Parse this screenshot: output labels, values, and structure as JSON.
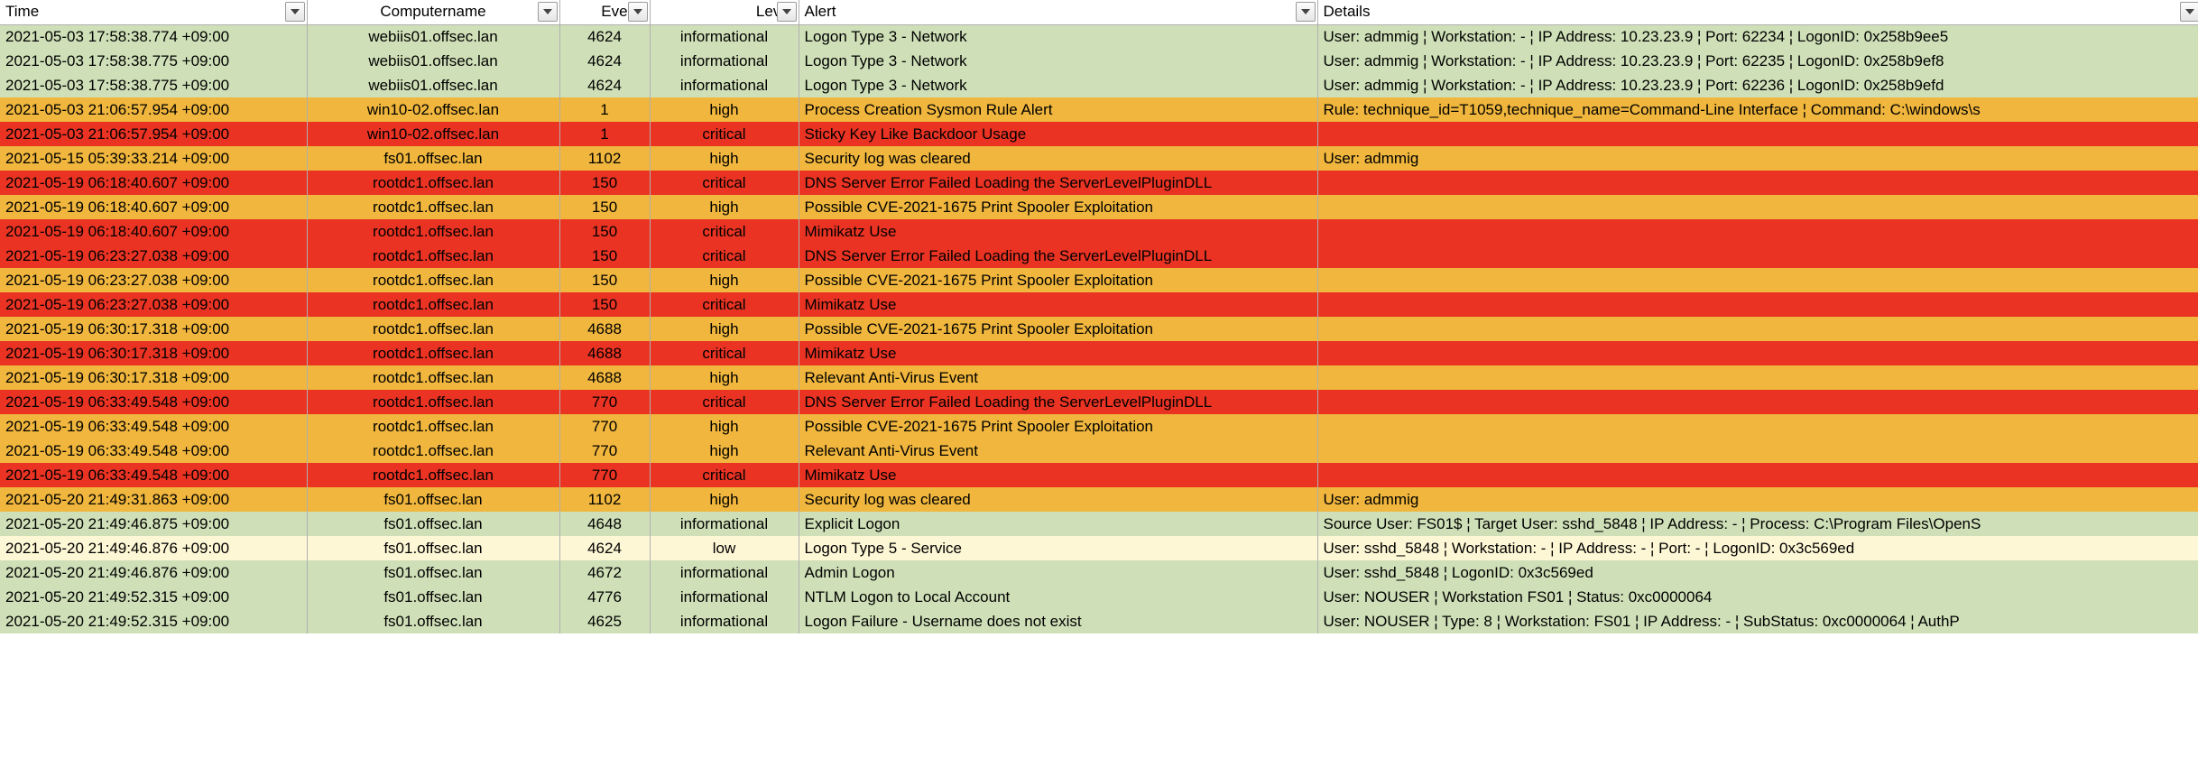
{
  "headers": {
    "time": "Time",
    "computer": "Computername",
    "eventid": "Eventi",
    "level": "Level",
    "alert": "Alert",
    "details": "Details"
  },
  "rows": [
    {
      "level": "informational",
      "time": "2021-05-03 17:58:38.774 +09:00",
      "computer": "webiis01.offsec.lan",
      "eventid": "4624",
      "levelText": "informational",
      "alert": "Logon Type 3 - Network",
      "details": "User: admmig  ¦  Workstation: -  ¦  IP Address: 10.23.23.9  ¦  Port: 62234  ¦  LogonID: 0x258b9ee5"
    },
    {
      "level": "informational",
      "time": "2021-05-03 17:58:38.775 +09:00",
      "computer": "webiis01.offsec.lan",
      "eventid": "4624",
      "levelText": "informational",
      "alert": "Logon Type 3 - Network",
      "details": "User: admmig  ¦  Workstation: -  ¦  IP Address: 10.23.23.9  ¦  Port: 62235  ¦  LogonID: 0x258b9ef8"
    },
    {
      "level": "informational",
      "time": "2021-05-03 17:58:38.775 +09:00",
      "computer": "webiis01.offsec.lan",
      "eventid": "4624",
      "levelText": "informational",
      "alert": "Logon Type 3 - Network",
      "details": "User: admmig  ¦  Workstation: -  ¦  IP Address: 10.23.23.9  ¦  Port: 62236  ¦  LogonID: 0x258b9efd"
    },
    {
      "level": "high",
      "time": "2021-05-03 21:06:57.954 +09:00",
      "computer": "win10-02.offsec.lan",
      "eventid": "1",
      "levelText": "high",
      "alert": "Process Creation Sysmon Rule Alert",
      "details": "Rule: technique_id=T1059,technique_name=Command-Line Interface  ¦  Command: C:\\windows\\s"
    },
    {
      "level": "critical",
      "time": "2021-05-03 21:06:57.954 +09:00",
      "computer": "win10-02.offsec.lan",
      "eventid": "1",
      "levelText": "critical",
      "alert": "Sticky Key Like Backdoor Usage",
      "details": ""
    },
    {
      "level": "high",
      "time": "2021-05-15 05:39:33.214 +09:00",
      "computer": "fs01.offsec.lan",
      "eventid": "1102",
      "levelText": "high",
      "alert": "Security log was cleared",
      "details": "User: admmig"
    },
    {
      "level": "critical",
      "time": "2021-05-19 06:18:40.607 +09:00",
      "computer": "rootdc1.offsec.lan",
      "eventid": "150",
      "levelText": "critical",
      "alert": "DNS Server Error Failed Loading the ServerLevelPluginDLL",
      "details": ""
    },
    {
      "level": "high",
      "time": "2021-05-19 06:18:40.607 +09:00",
      "computer": "rootdc1.offsec.lan",
      "eventid": "150",
      "levelText": "high",
      "alert": "Possible CVE-2021-1675 Print Spooler Exploitation",
      "details": ""
    },
    {
      "level": "critical",
      "time": "2021-05-19 06:18:40.607 +09:00",
      "computer": "rootdc1.offsec.lan",
      "eventid": "150",
      "levelText": "critical",
      "alert": "Mimikatz Use",
      "details": ""
    },
    {
      "level": "critical",
      "time": "2021-05-19 06:23:27.038 +09:00",
      "computer": "rootdc1.offsec.lan",
      "eventid": "150",
      "levelText": "critical",
      "alert": "DNS Server Error Failed Loading the ServerLevelPluginDLL",
      "details": ""
    },
    {
      "level": "high",
      "time": "2021-05-19 06:23:27.038 +09:00",
      "computer": "rootdc1.offsec.lan",
      "eventid": "150",
      "levelText": "high",
      "alert": "Possible CVE-2021-1675 Print Spooler Exploitation",
      "details": ""
    },
    {
      "level": "critical",
      "time": "2021-05-19 06:23:27.038 +09:00",
      "computer": "rootdc1.offsec.lan",
      "eventid": "150",
      "levelText": "critical",
      "alert": "Mimikatz Use",
      "details": ""
    },
    {
      "level": "high",
      "time": "2021-05-19 06:30:17.318 +09:00",
      "computer": "rootdc1.offsec.lan",
      "eventid": "4688",
      "levelText": "high",
      "alert": "Possible CVE-2021-1675 Print Spooler Exploitation",
      "details": ""
    },
    {
      "level": "critical",
      "time": "2021-05-19 06:30:17.318 +09:00",
      "computer": "rootdc1.offsec.lan",
      "eventid": "4688",
      "levelText": "critical",
      "alert": "Mimikatz Use",
      "details": ""
    },
    {
      "level": "high",
      "time": "2021-05-19 06:30:17.318 +09:00",
      "computer": "rootdc1.offsec.lan",
      "eventid": "4688",
      "levelText": "high",
      "alert": "Relevant Anti-Virus Event",
      "details": ""
    },
    {
      "level": "critical",
      "time": "2021-05-19 06:33:49.548 +09:00",
      "computer": "rootdc1.offsec.lan",
      "eventid": "770",
      "levelText": "critical",
      "alert": "DNS Server Error Failed Loading the ServerLevelPluginDLL",
      "details": ""
    },
    {
      "level": "high",
      "time": "2021-05-19 06:33:49.548 +09:00",
      "computer": "rootdc1.offsec.lan",
      "eventid": "770",
      "levelText": "high",
      "alert": "Possible CVE-2021-1675 Print Spooler Exploitation",
      "details": ""
    },
    {
      "level": "high",
      "time": "2021-05-19 06:33:49.548 +09:00",
      "computer": "rootdc1.offsec.lan",
      "eventid": "770",
      "levelText": "high",
      "alert": "Relevant Anti-Virus Event",
      "details": ""
    },
    {
      "level": "critical",
      "time": "2021-05-19 06:33:49.548 +09:00",
      "computer": "rootdc1.offsec.lan",
      "eventid": "770",
      "levelText": "critical",
      "alert": "Mimikatz Use",
      "details": ""
    },
    {
      "level": "high",
      "time": "2021-05-20 21:49:31.863 +09:00",
      "computer": "fs01.offsec.lan",
      "eventid": "1102",
      "levelText": "high",
      "alert": "Security log was cleared",
      "details": "User: admmig"
    },
    {
      "level": "informational",
      "time": "2021-05-20 21:49:46.875 +09:00",
      "computer": "fs01.offsec.lan",
      "eventid": "4648",
      "levelText": "informational",
      "alert": "Explicit Logon",
      "details": "Source User: FS01$  ¦  Target User: sshd_5848  ¦  IP Address: -  ¦  Process: C:\\Program Files\\OpenS"
    },
    {
      "level": "low",
      "time": "2021-05-20 21:49:46.876 +09:00",
      "computer": "fs01.offsec.lan",
      "eventid": "4624",
      "levelText": "low",
      "alert": "Logon Type 5 - Service",
      "details": "User: sshd_5848  ¦  Workstation: -  ¦  IP Address: -  ¦  Port: -  ¦  LogonID: 0x3c569ed"
    },
    {
      "level": "informational",
      "time": "2021-05-20 21:49:46.876 +09:00",
      "computer": "fs01.offsec.lan",
      "eventid": "4672",
      "levelText": "informational",
      "alert": "Admin Logon",
      "details": "User: sshd_5848  ¦  LogonID: 0x3c569ed"
    },
    {
      "level": "informational",
      "time": "2021-05-20 21:49:52.315 +09:00",
      "computer": "fs01.offsec.lan",
      "eventid": "4776",
      "levelText": "informational",
      "alert": "NTLM Logon to Local Account",
      "details": "User: NOUSER  ¦  Workstation FS01  ¦  Status: 0xc0000064"
    },
    {
      "level": "informational",
      "time": "2021-05-20 21:49:52.315 +09:00",
      "computer": "fs01.offsec.lan",
      "eventid": "4625",
      "levelText": "informational",
      "alert": "Logon Failure - Username does not exist",
      "details": "User: NOUSER  ¦  Type: 8  ¦  Workstation: FS01  ¦  IP Address: -  ¦  SubStatus: 0xc0000064  ¦  AuthP"
    }
  ]
}
